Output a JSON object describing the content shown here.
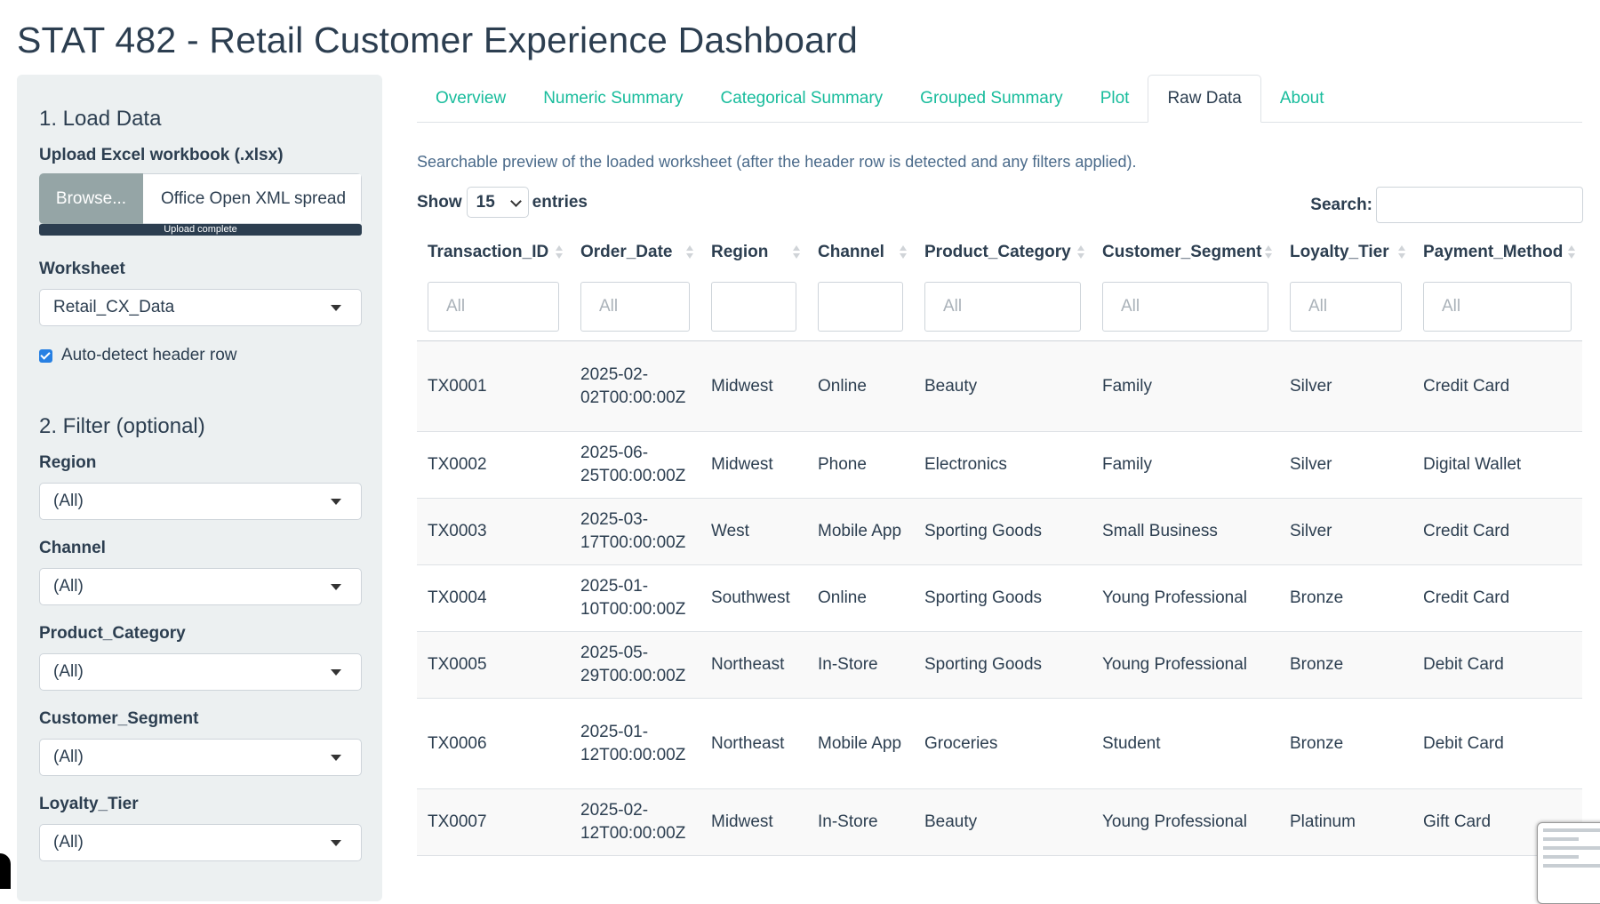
{
  "app_title": "STAT 482 - Retail Customer Experience Dashboard",
  "sidebar": {
    "load_heading": "1. Load Data",
    "upload_label": "Upload Excel workbook (.xlsx)",
    "browse_label": "Browse...",
    "file_name": "Office Open XML spread",
    "upload_status": "Upload complete",
    "upload_progress": 1.0,
    "worksheet_label": "Worksheet",
    "worksheet_value": "Retail_CX_Data",
    "auto_detect_label": "Auto-detect header row",
    "auto_detect_checked": true,
    "filter_heading": "2. Filter (optional)",
    "filters": [
      {
        "label": "Region",
        "value": "(All)"
      },
      {
        "label": "Channel",
        "value": "(All)"
      },
      {
        "label": "Product_Category",
        "value": "(All)"
      },
      {
        "label": "Customer_Segment",
        "value": "(All)"
      },
      {
        "label": "Loyalty_Tier",
        "value": "(All)"
      }
    ]
  },
  "tabs": [
    {
      "label": "Overview",
      "active": false
    },
    {
      "label": "Numeric Summary",
      "active": false
    },
    {
      "label": "Categorical Summary",
      "active": false
    },
    {
      "label": "Grouped Summary",
      "active": false
    },
    {
      "label": "Plot",
      "active": false
    },
    {
      "label": "Raw Data",
      "active": true
    },
    {
      "label": "About",
      "active": false
    }
  ],
  "raw_data": {
    "description": "Searchable preview of the loaded worksheet (after the header row is detected and any filters applied).",
    "show_label": "Show",
    "entries_value": "15",
    "entries_label": "entries",
    "search_label": "Search:",
    "columns": [
      "Transaction_ID",
      "Order_Date",
      "Region",
      "Channel",
      "Product_Category",
      "Customer_Segment",
      "Loyalty_Tier",
      "Payment_Method"
    ],
    "column_filters": [
      "All",
      "All",
      "",
      "",
      "All",
      "All",
      "All",
      "All"
    ],
    "rows": [
      [
        "TX0001",
        "2025-02-02T00:00:00Z",
        "Midwest",
        "Online",
        "Beauty",
        "Family",
        "Silver",
        "Credit Card"
      ],
      [
        "TX0002",
        "2025-06-25T00:00:00Z",
        "Midwest",
        "Phone",
        "Electronics",
        "Family",
        "Silver",
        "Digital Wallet"
      ],
      [
        "TX0003",
        "2025-03-17T00:00:00Z",
        "West",
        "Mobile App",
        "Sporting Goods",
        "Small Business",
        "Silver",
        "Credit Card"
      ],
      [
        "TX0004",
        "2025-01-10T00:00:00Z",
        "Southwest",
        "Online",
        "Sporting Goods",
        "Young Professional",
        "Bronze",
        "Credit Card"
      ],
      [
        "TX0005",
        "2025-05-29T00:00:00Z",
        "Northeast",
        "In-Store",
        "Sporting Goods",
        "Young Professional",
        "Bronze",
        "Debit Card"
      ],
      [
        "TX0006",
        "2025-01-12T00:00:00Z",
        "Northeast",
        "Mobile App",
        "Groceries",
        "Student",
        "Bronze",
        "Debit Card"
      ],
      [
        "TX0007",
        "2025-02-12T00:00:00Z",
        "Midwest",
        "In-Store",
        "Beauty",
        "Young Professional",
        "Platinum",
        "Gift Card"
      ]
    ]
  },
  "colors": {
    "primary": "#2c3e50",
    "tab_link": "#18bc9c",
    "sidebar_bg": "#ecf0f1",
    "checkbox": "#2780e3",
    "browse_button": "#95a5a6"
  }
}
